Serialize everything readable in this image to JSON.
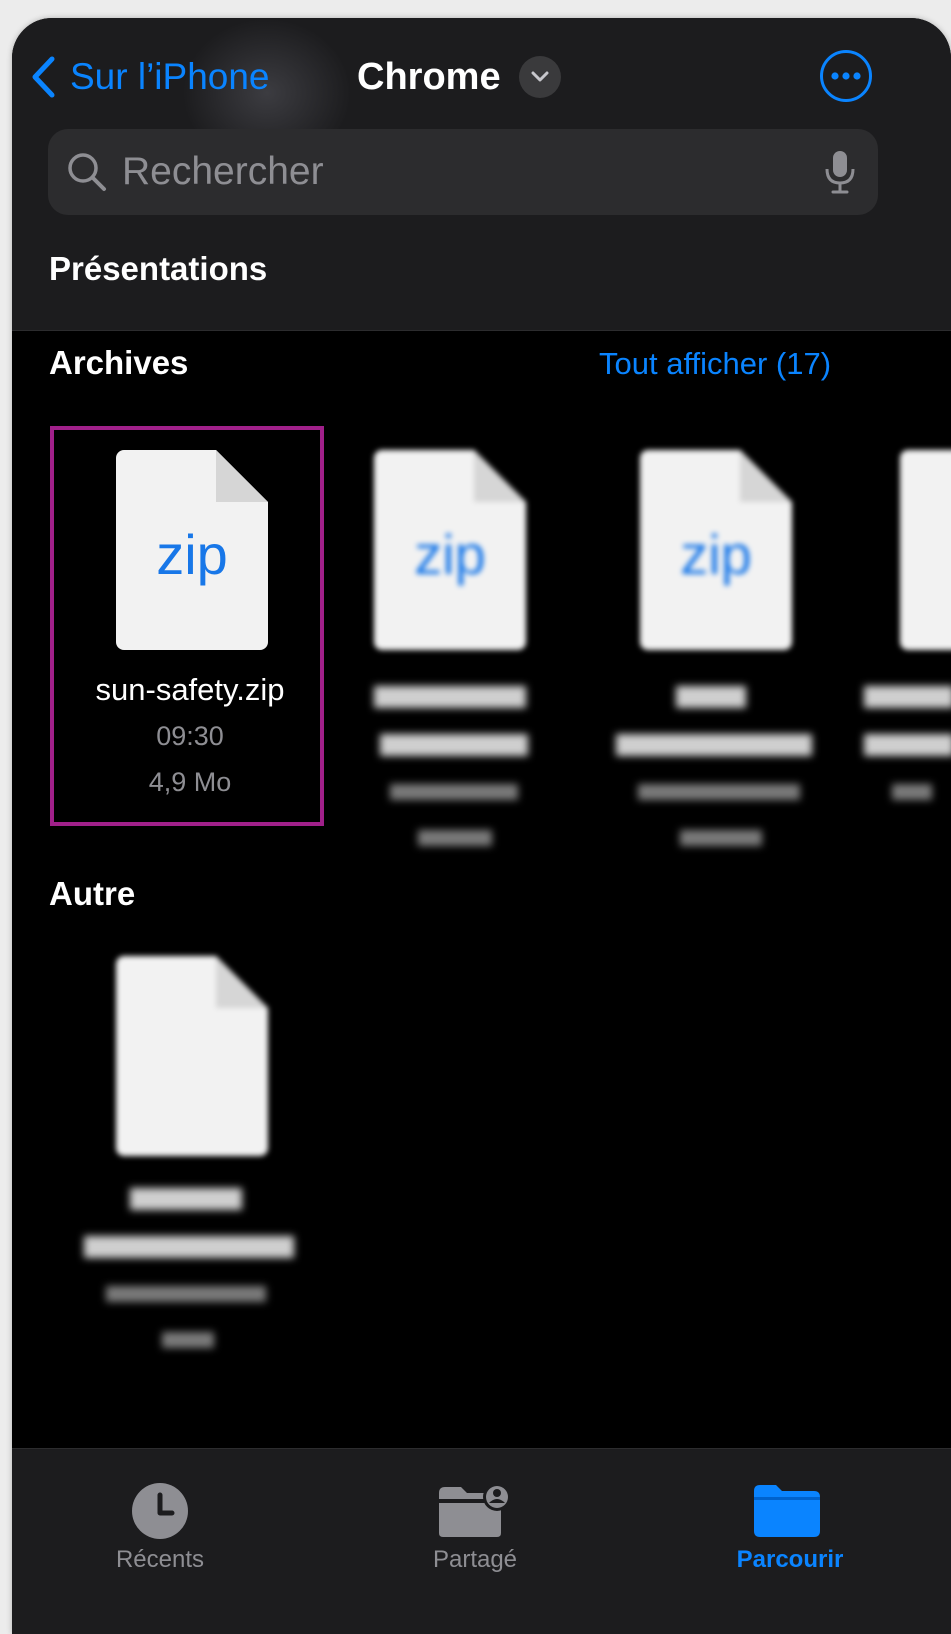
{
  "nav": {
    "back_label": "Sur l’iPhone",
    "title": "Chrome"
  },
  "search": {
    "placeholder": "Rechercher"
  },
  "sections": {
    "presentations": "Présentations",
    "archives": "Archives",
    "archives_show_all": "Tout afficher (17)",
    "other": "Autre"
  },
  "archives_files": [
    {
      "name": "sun-safety.zip",
      "time": "09:30",
      "size": "4,9 Mo",
      "ext": "zip"
    },
    {
      "ext": "zip"
    },
    {
      "ext": "zip"
    }
  ],
  "tabs": [
    {
      "label": "Récents",
      "icon": "clock-icon"
    },
    {
      "label": "Partagé",
      "icon": "shared-folder-icon"
    },
    {
      "label": "Parcourir",
      "icon": "folder-icon"
    }
  ],
  "colors": {
    "accent": "#0a84ff",
    "highlight": "#a0208a",
    "background": "#000000",
    "header": "#1c1c1e"
  }
}
